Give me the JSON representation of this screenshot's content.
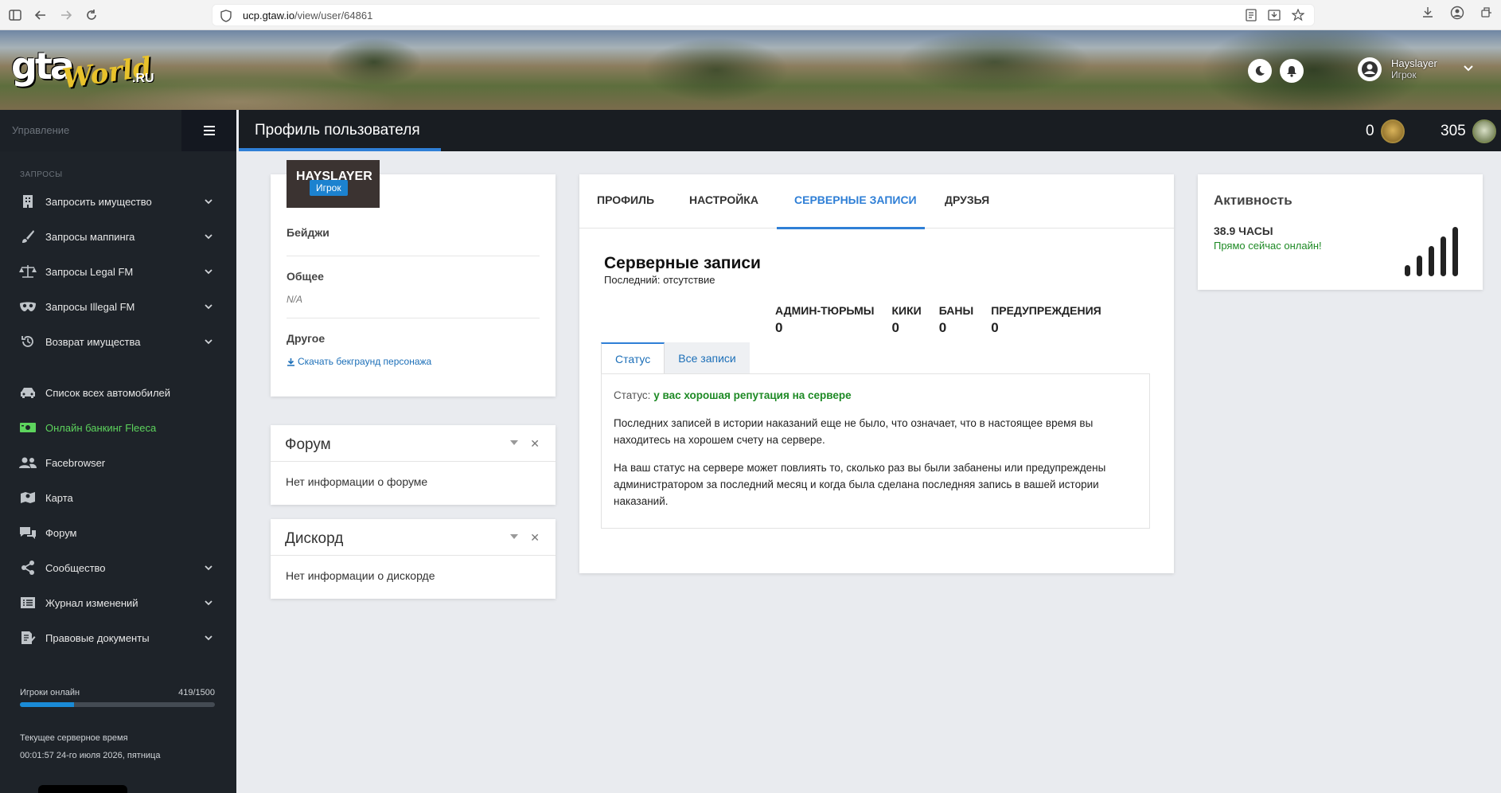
{
  "browser": {
    "url_host": "ucp.gtaw.io",
    "url_path": "/view/user/64861"
  },
  "header": {
    "logo_text": "gtaWorld.ru",
    "user_name": "Hayslayer",
    "user_role": "Игрок"
  },
  "sidebar": {
    "top_label": "Управление",
    "section_label": "ЗАПРОСЫ",
    "items": [
      {
        "label": "Запросить имущество",
        "icon": "building-icon",
        "expandable": true
      },
      {
        "label": "Запросы маппинга",
        "icon": "brush-icon",
        "expandable": true
      },
      {
        "label": "Запросы Legal FM",
        "icon": "scale-icon",
        "expandable": true
      },
      {
        "label": "Запросы Illegal FM",
        "icon": "mask-icon",
        "expandable": true
      },
      {
        "label": "Возврат имущества",
        "icon": "history-icon",
        "expandable": true
      },
      {
        "label": "Список всех автомобилей",
        "icon": "car-icon",
        "expandable": false
      },
      {
        "label": "Онлайн банкинг Fleeca",
        "icon": "money-icon",
        "expandable": false,
        "active": true
      },
      {
        "label": "Facebrowser",
        "icon": "users-icon",
        "expandable": false
      },
      {
        "label": "Карта",
        "icon": "map-icon",
        "expandable": false
      },
      {
        "label": "Форум",
        "icon": "comments-icon",
        "expandable": false
      },
      {
        "label": "Сообщество",
        "icon": "share-icon",
        "expandable": true
      },
      {
        "label": "Журнал изменений",
        "icon": "list-icon",
        "expandable": true
      },
      {
        "label": "Правовые документы",
        "icon": "document-icon",
        "expandable": true
      }
    ],
    "players_label": "Игроки онлайн",
    "players_count": "419/1500",
    "players_fraction": 0.279,
    "time_label": "Текущее серверное время",
    "time_value": "00:01:57 24-го июля 2026, пятница"
  },
  "titlebar": {
    "title": "Профиль пользователя",
    "stat1": "0",
    "stat2": "305"
  },
  "profile": {
    "name": "HAYSLAYER",
    "role": "Игрок",
    "badges_label": "Бейджи",
    "general_label": "Общее",
    "general_value": "N/A",
    "other_label": "Другое",
    "download_link": "Скачать бекграунд персонажа"
  },
  "forum_card": {
    "title": "Форум",
    "body": "Нет информации о форуме"
  },
  "discord_card": {
    "title": "Дискорд",
    "body": "Нет информации о дискорде"
  },
  "records": {
    "tabs": [
      "ПРОФИЛЬ",
      "НАСТРОЙКА",
      "СЕРВЕРНЫЕ ЗАПИСИ",
      "ДРУЗЬЯ"
    ],
    "active_tab": 2,
    "title": "Серверные записи",
    "subtitle": "Последний: отсутствие",
    "counters": [
      {
        "label": "АДМИН-ТЮРЬМЫ",
        "value": "0"
      },
      {
        "label": "КИКИ",
        "value": "0"
      },
      {
        "label": "БАНЫ",
        "value": "0"
      },
      {
        "label": "ПРЕДУПРЕЖДЕНИЯ",
        "value": "0"
      }
    ],
    "sub_tabs": [
      "Статус",
      "Все записи"
    ],
    "status_label": "Статус:",
    "status_value": "у вас хорошая репутация на сервере",
    "paragraph1": "Последних записей в истории наказаний еще не было, что означает, что в настоящее время вы находитесь на хорошем счету на сервере.",
    "paragraph2": "На ваш статус на сервере может повлиять то, сколько раз вы были забанены или предупреждены администратором за последний месяц и когда была сделана последняя запись в вашей истории наказаний."
  },
  "activity": {
    "title": "Активность",
    "hours": "38.9 ЧАСЫ",
    "online": "Прямо сейчас онлайн!"
  },
  "colors": {
    "accent": "#2f7fd6",
    "sidebar_bg": "#1e2329",
    "success": "#1e8a25",
    "active_nav": "#5dd45d"
  }
}
